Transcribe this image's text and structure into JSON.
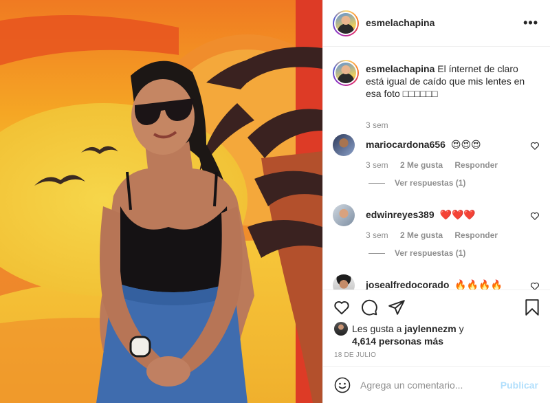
{
  "post": {
    "author": "esmelachapina",
    "more_icon": "more-horizontal-icon",
    "caption": {
      "username": "esmelachapina",
      "text": "El ínternet de claro está igual de caído que mis lentes en esa foto □□□□□□",
      "time": "3 sem"
    },
    "comments": [
      {
        "username": "mariocardona656",
        "text": "😍😍😍",
        "time": "3 sem",
        "likes": "2 Me gusta",
        "reply": "Responder",
        "view_replies": "Ver respuestas (1)"
      },
      {
        "username": "edwinreyes389",
        "text": "❤️❤️❤️",
        "time": "3 sem",
        "likes": "2 Me gusta",
        "reply": "Responder",
        "view_replies": "Ver respuestas (1)"
      },
      {
        "username": "josealfredocorado",
        "text": "🔥🔥🔥🔥"
      }
    ],
    "likes": {
      "prefix": "Les gusta a",
      "user": "jaylennezm",
      "suffix": "y",
      "others": "4,614 personas más"
    },
    "date": "18 DE JULIO",
    "add_comment": {
      "placeholder": "Agrega un comentario...",
      "publish_label": "Publicar"
    }
  },
  "colors": {
    "publish_disabled": "#b2dffc",
    "muted_text": "#8e8e8e",
    "heart_red": "#ed4956"
  }
}
